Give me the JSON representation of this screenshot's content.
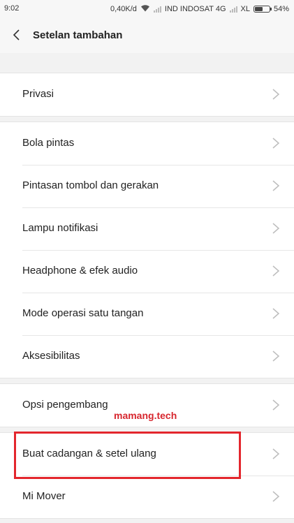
{
  "status_bar": {
    "time": "9:02",
    "speed": "0,40K/d",
    "carrier1": "IND INDOSAT 4G",
    "carrier2": "XL",
    "battery_text": "54%",
    "battery_level": 0.54
  },
  "header": {
    "title": "Setelan tambahan",
    "back_icon": "chevron-left-icon"
  },
  "groups": [
    {
      "items": [
        "Privasi"
      ]
    },
    {
      "items": [
        "Bola pintas",
        "Pintasan tombol dan gerakan",
        "Lampu notifikasi",
        "Headphone & efek audio",
        "Mode operasi satu tangan",
        "Aksesibilitas"
      ]
    },
    {
      "items": [
        "Opsi pengembang"
      ]
    },
    {
      "items": [
        "Buat cadangan & setel ulang",
        "Mi Mover"
      ]
    }
  ],
  "annotation": {
    "watermark": "mamang.tech",
    "highlight_color": "#e3262d"
  },
  "colors": {
    "background": "#f2f2f2",
    "row_background": "#ffffff",
    "chevron": "#bdbdbd"
  }
}
